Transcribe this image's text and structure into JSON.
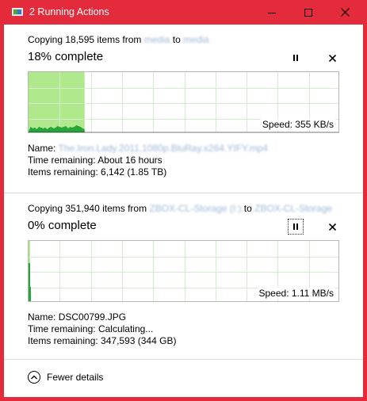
{
  "window": {
    "title": "2 Running Actions",
    "accent_color": "#e32b3b"
  },
  "operations": [
    {
      "copy_prefix": "Copying 18,595 items from",
      "source": "media",
      "to_word": "to",
      "destination": "media",
      "percent_text": "18% complete",
      "progress_percent": 18,
      "speed_text": "Speed: 355 KB/s",
      "name_label": "Name:",
      "name_value": "The.Iron.Lady.2011.1080p.BluRay.x264.YIFY.mp4",
      "time_label": "Time remaining:",
      "time_value": "About 16 hours",
      "items_label": "Items remaining:",
      "items_value": "6,142 (1.85 TB)",
      "throughput_samples": [
        3,
        9,
        7,
        8,
        6,
        9,
        8,
        7,
        8,
        6,
        8,
        9,
        7,
        8,
        10,
        9,
        8,
        9,
        10,
        7,
        9,
        8,
        9,
        11,
        10,
        9,
        7,
        6
      ]
    },
    {
      "copy_prefix": "Copying 351,940 items from",
      "source": "ZBOX-CL-Storage (I:)",
      "to_word": "to",
      "destination": "ZBOX-CL-Storage",
      "percent_text": "0% complete",
      "progress_percent": 0,
      "speed_text": "Speed: 1.11 MB/s",
      "name_label": "Name:",
      "name_value": "DSC00799.JPG",
      "time_label": "Time remaining:",
      "time_value": "Calculating...",
      "items_label": "Items remaining:",
      "items_value": "347,593 (344 GB)",
      "throughput_samples": [
        50,
        20
      ]
    }
  ],
  "footer": {
    "fewer_details_label": "Fewer details"
  },
  "icons": {
    "pause": "pause-icon",
    "cancel": "close-icon",
    "collapse": "chevron-up-icon"
  }
}
